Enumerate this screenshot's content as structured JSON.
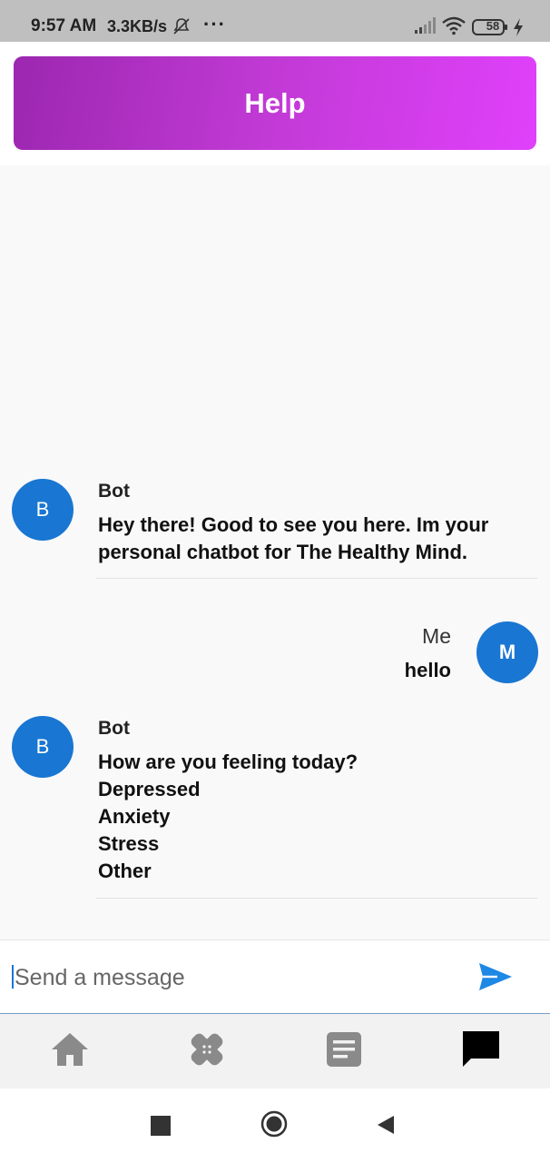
{
  "status_bar": {
    "time": "9:57 AM",
    "net_speed": "3.3KB/s",
    "more": "···",
    "battery": "58"
  },
  "header": {
    "title": "Help"
  },
  "messages": [
    {
      "sender": "Bot",
      "avatar": "B",
      "lines": [
        "Hey there! Good to see you here. Im your personal chatbot for The Healthy Mind."
      ]
    },
    {
      "sender": "Me",
      "avatar": "M",
      "lines": [
        "hello"
      ]
    },
    {
      "sender": "Bot",
      "avatar": "B",
      "lines": [
        "How are you feeling today?",
        "Depressed",
        "Anxiety",
        "Stress",
        "Other"
      ]
    }
  ],
  "composer": {
    "placeholder": "Send a message",
    "send_icon": "send-icon"
  },
  "bottom_nav": [
    {
      "icon": "home-icon",
      "active": false
    },
    {
      "icon": "bandage-icon",
      "active": false
    },
    {
      "icon": "article-icon",
      "active": false
    },
    {
      "icon": "chat-icon",
      "active": true
    }
  ],
  "colors": {
    "accent": "#1976d2",
    "header_start": "#9c27b0",
    "header_end": "#e040fb"
  }
}
